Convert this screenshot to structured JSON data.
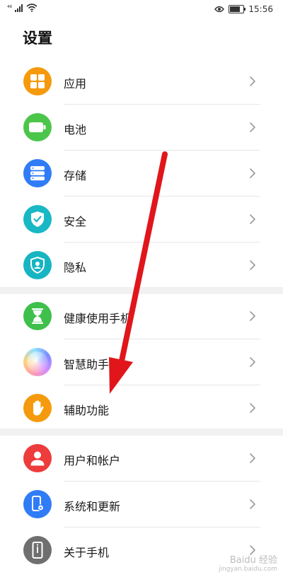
{
  "status_bar": {
    "signal_label": "⁴⁶",
    "time": "15:56",
    "battery_level": 0.8,
    "icons": [
      "signal-icon",
      "wifi-icon",
      "eye-icon",
      "battery-icon"
    ]
  },
  "page": {
    "title": "设置"
  },
  "groups": [
    [
      {
        "id": "apps",
        "label": "应用",
        "icon": "apps-grid-icon",
        "color": "#f59a0c"
      },
      {
        "id": "battery",
        "label": "电池",
        "icon": "battery-icon",
        "color": "#4cc64a"
      },
      {
        "id": "storage",
        "label": "存储",
        "icon": "storage-icon",
        "color": "#2f7cf6"
      },
      {
        "id": "security",
        "label": "安全",
        "icon": "shield-check-icon",
        "color": "#18b8c4"
      },
      {
        "id": "privacy",
        "label": "隐私",
        "icon": "privacy-shield-icon",
        "color": "#17b5c2"
      }
    ],
    [
      {
        "id": "digital-balance",
        "label": "健康使用手机",
        "icon": "hourglass-icon",
        "color": "#3fbf4b"
      },
      {
        "id": "assistant",
        "label": "智慧助手",
        "icon": "assistant-orb-icon",
        "color": "#c9a7f0"
      },
      {
        "id": "accessibility",
        "label": "辅助功能",
        "icon": "hand-icon",
        "color": "#f59a0c"
      }
    ],
    [
      {
        "id": "users",
        "label": "用户和帐户",
        "icon": "user-icon",
        "color": "#ee3b3b"
      },
      {
        "id": "system",
        "label": "系统和更新",
        "icon": "phone-settings-icon",
        "color": "#2f7cf6"
      },
      {
        "id": "about",
        "label": "关于手机",
        "icon": "phone-info-icon",
        "color": "#6f6f6f"
      }
    ]
  ],
  "annotation": {
    "color": "#e0161b"
  },
  "watermark": {
    "text": "Baidu 经验",
    "sub": "jingyan.baidu.com"
  }
}
